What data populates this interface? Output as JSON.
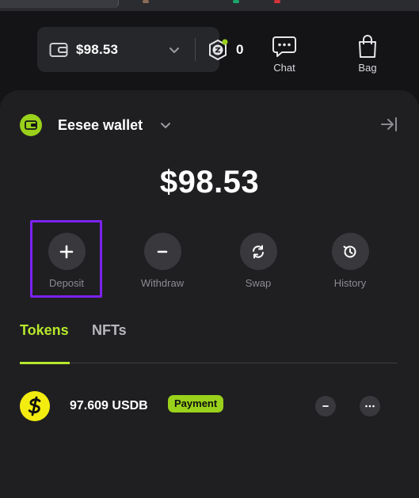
{
  "topbar": {
    "balance": "$98.53",
    "points": "0",
    "actions": [
      {
        "label": "Chat",
        "icon": "chat-icon"
      },
      {
        "label": "Bag",
        "icon": "bag-icon"
      }
    ]
  },
  "wallet": {
    "title": "Eesee wallet",
    "balance": "$98.53",
    "actions": [
      {
        "label": "Deposit",
        "icon": "plus-icon"
      },
      {
        "label": "Withdraw",
        "icon": "minus-icon"
      },
      {
        "label": "Swap",
        "icon": "swap-icon"
      },
      {
        "label": "History",
        "icon": "history-icon"
      }
    ]
  },
  "tabs": [
    "Tokens",
    "NFTs"
  ],
  "active_tab": "Tokens",
  "tokens": [
    {
      "amount": "97.609 USDB",
      "badge": "Payment",
      "icon": "usdb-icon"
    }
  ],
  "colors": {
    "accent": "#b6e82b",
    "badge": "#9ad11a",
    "highlight": "#7c22f0",
    "panel": "#1f1f22",
    "token_yellow": "#f3ec10"
  }
}
